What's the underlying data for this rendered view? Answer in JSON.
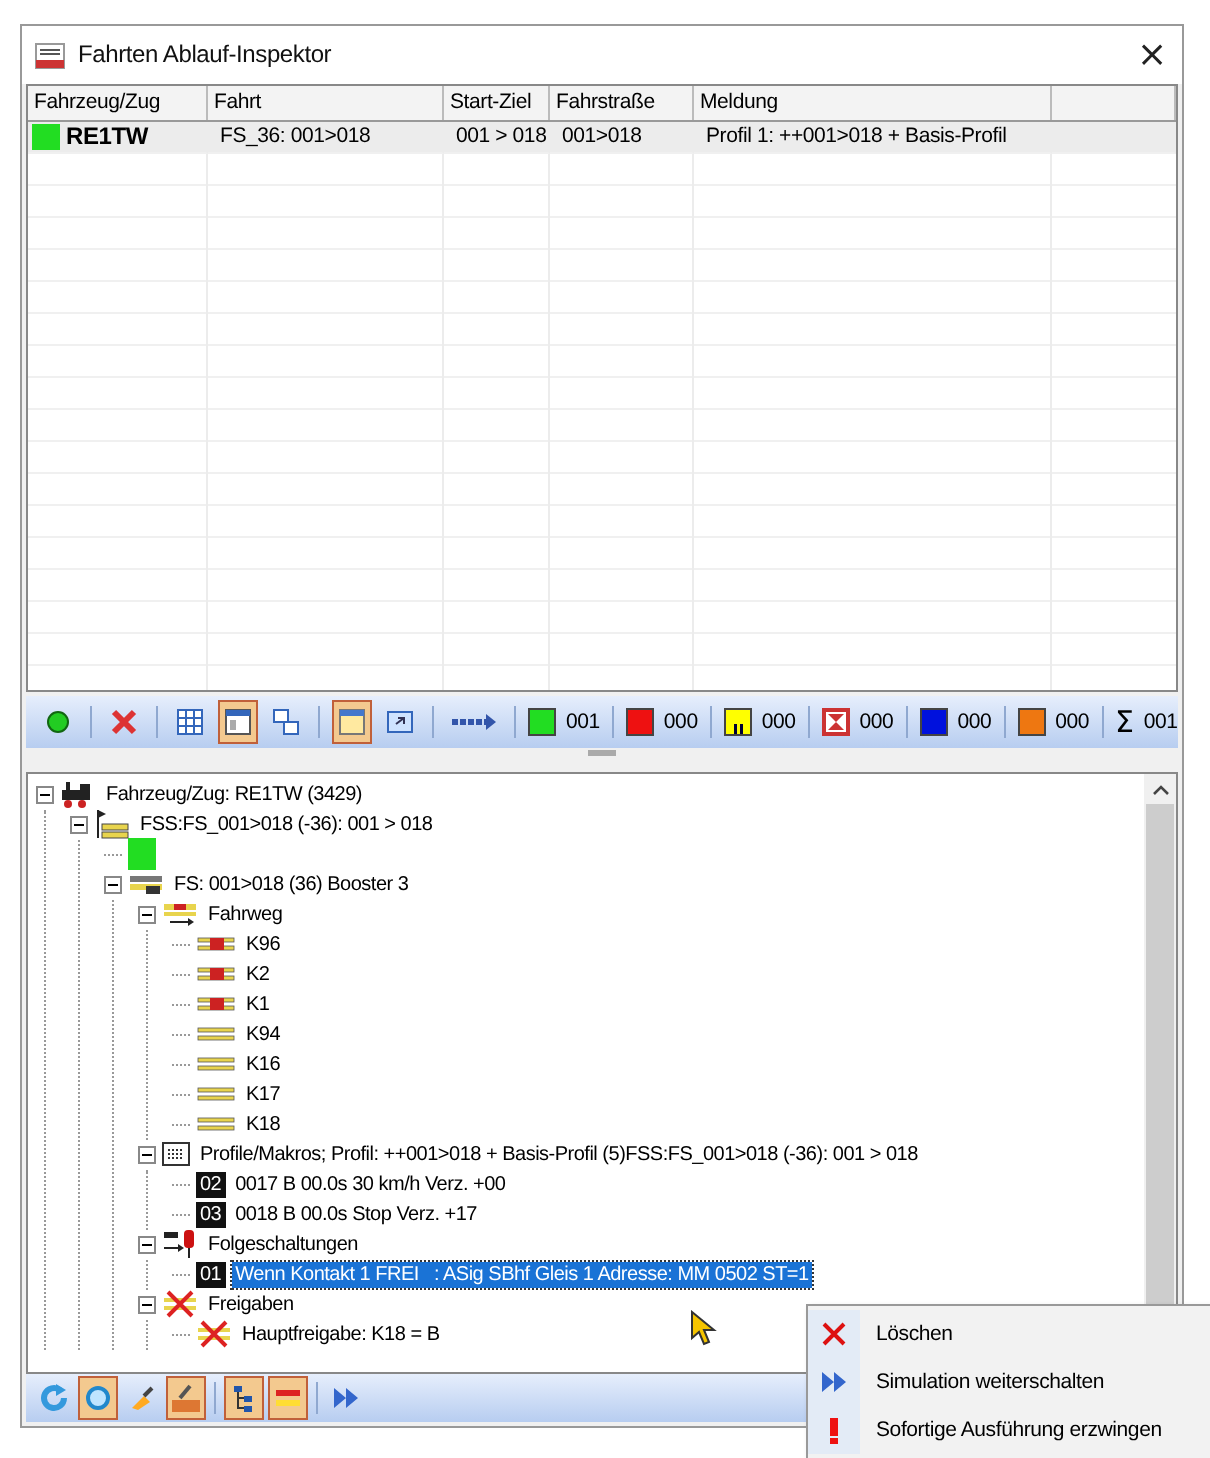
{
  "window": {
    "title": "Fahrten Ablauf-Inspektor",
    "close": "×"
  },
  "table": {
    "columns": [
      "Fahrzeug/Zug",
      "Fahrt",
      "Start-Ziel",
      "Fahrstraße",
      "Meldung"
    ],
    "rows": [
      {
        "color": "#22dd22",
        "vehicle": "RE1TW",
        "trip": "FS_36: 001>018",
        "start_end": "001 > 018",
        "route": "001>018",
        "message": "Profil 1: ++001>018 + Basis-Profil",
        "selected": true
      }
    ]
  },
  "toolbar": {
    "buttons": [
      {
        "kind": "status",
        "pressed": false
      },
      {
        "kind": "delete",
        "pressed": false
      },
      {
        "kind": "grid",
        "pressed": false
      },
      {
        "kind": "window",
        "pressed": true
      },
      {
        "kind": "cascade",
        "pressed": false
      },
      {
        "kind": "note",
        "pressed": true
      },
      {
        "kind": "restore",
        "pressed": false
      },
      {
        "kind": "arrow",
        "pressed": false
      }
    ],
    "counters": [
      {
        "kind": "square",
        "color": "#22dd22",
        "count": "001"
      },
      {
        "kind": "square",
        "color": "#ee1111",
        "count": "000"
      },
      {
        "kind": "paused",
        "color": "#ffff00",
        "count": "000"
      },
      {
        "kind": "timer",
        "color": "#cc3333",
        "count": "000"
      },
      {
        "kind": "square",
        "color": "#0011dd",
        "count": "000"
      },
      {
        "kind": "square",
        "color": "#ee7711",
        "count": "000"
      },
      {
        "kind": "sum",
        "symbol": "Σ",
        "count": "001"
      }
    ]
  },
  "tree": [
    {
      "kind": "train",
      "label": "Fahrzeug/Zug: RE1TW (3429)",
      "expanded": true,
      "children": [
        {
          "kind": "route-set",
          "label": "FSS:FS_001>018 (-36): 001 > 018",
          "expanded": true,
          "children": [
            {
              "kind": "color",
              "color": "#22dd22"
            },
            {
              "kind": "route",
              "label": "FS: 001>018 (36) Booster 3",
              "expanded": true,
              "children": [
                {
                  "kind": "path",
                  "label": "Fahrweg",
                  "expanded": true,
                  "children": [
                    {
                      "kind": "contact",
                      "occupied": true,
                      "label": "K96"
                    },
                    {
                      "kind": "contact",
                      "occupied": true,
                      "label": "K2"
                    },
                    {
                      "kind": "contact",
                      "occupied": true,
                      "label": "K1"
                    },
                    {
                      "kind": "contact",
                      "occupied": false,
                      "label": "K94"
                    },
                    {
                      "kind": "contact",
                      "occupied": false,
                      "label": "K16"
                    },
                    {
                      "kind": "contact",
                      "occupied": false,
                      "label": "K17"
                    },
                    {
                      "kind": "contact",
                      "occupied": false,
                      "label": "K18"
                    }
                  ]
                },
                {
                  "kind": "profile",
                  "label": "Profile/Makros; Profil: ++001>018 + Basis-Profil (5)FSS:FS_001>018 (-36): 001 > 018",
                  "expanded": true,
                  "children": [
                    {
                      "kind": "step",
                      "number": "02",
                      "label": "0017 B 00.0s 30 km/h Verz. +00",
                      "selected": false
                    },
                    {
                      "kind": "step",
                      "number": "03",
                      "label": "0018 B 00.0s Stop Verz. +17",
                      "selected": false
                    }
                  ]
                },
                {
                  "kind": "switching",
                  "label": "Folgeschaltungen",
                  "expanded": true,
                  "children": [
                    {
                      "kind": "step",
                      "number": "01",
                      "label": "Wenn Kontakt 1 FREI   : ASig SBhf Gleis 1 Adresse: MM 0502 ST=1",
                      "selected": true
                    }
                  ]
                },
                {
                  "kind": "release",
                  "label": "Freigaben",
                  "expanded": true,
                  "children": [
                    {
                      "kind": "release",
                      "label": "Hauptfreigabe: K18 = B"
                    }
                  ]
                }
              ]
            }
          ]
        }
      ]
    }
  ],
  "bottom_toolbar": [
    {
      "kind": "refresh",
      "pressed": false
    },
    {
      "kind": "sync",
      "pressed": true
    },
    {
      "kind": "tool",
      "pressed": false
    },
    {
      "kind": "auto",
      "pressed": true
    },
    {
      "kind": "tree",
      "pressed": true
    },
    {
      "kind": "tracks",
      "pressed": true
    },
    {
      "kind": "forward",
      "pressed": false
    }
  ],
  "context_menu": [
    {
      "kind": "delete",
      "label": "Löschen"
    },
    {
      "kind": "forward",
      "label": "Simulation weiterschalten"
    },
    {
      "kind": "force",
      "label": "Sofortige Ausführung erzwingen"
    }
  ]
}
